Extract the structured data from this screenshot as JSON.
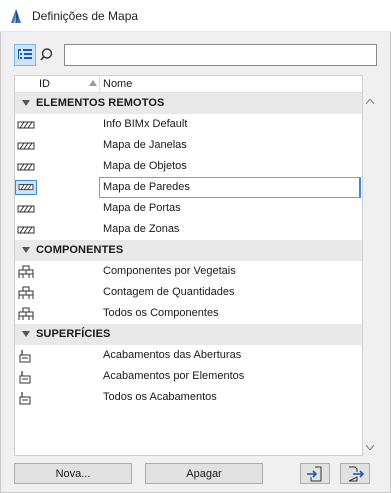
{
  "window": {
    "title": "Definições de Mapa"
  },
  "toolbar": {
    "search_value": ""
  },
  "list": {
    "columns": {
      "id": "ID",
      "name": "Nome"
    },
    "groups": [
      {
        "label": "ELEMENTOS REMOTOS",
        "items": [
          {
            "name": "Info BIMx Default"
          },
          {
            "name": "Mapa de Janelas"
          },
          {
            "name": "Mapa de Objetos"
          },
          {
            "name": "Mapa de Paredes",
            "selected": true
          },
          {
            "name": "Mapa de Portas"
          },
          {
            "name": "Mapa de Zonas"
          }
        ]
      },
      {
        "label": "COMPONENTES",
        "items": [
          {
            "name": "Componentes por Vegetais"
          },
          {
            "name": "Contagem de Quantidades"
          },
          {
            "name": "Todos os Componentes"
          }
        ]
      },
      {
        "label": "SUPERFÍCIES",
        "items": [
          {
            "name": "Acabamentos das Aberturas"
          },
          {
            "name": "Acabamentos por Elementos"
          },
          {
            "name": "Todos os Acabamentos"
          }
        ]
      }
    ]
  },
  "buttons": {
    "new_label": "Nova...",
    "delete_label": "Apagar"
  },
  "colors": {
    "accent": "#3b8ad8",
    "selection_fill": "#cfe3f7",
    "group_bg": "#e9e9e9"
  },
  "icons": {
    "app": "archicad-icon",
    "view_toggle": "tree-view-icon",
    "search": "search-icon",
    "remote_element": "hatch-element-icon",
    "component": "component-stack-icon",
    "surface": "paint-brush-icon",
    "import": "import-icon",
    "export": "export-icon"
  }
}
